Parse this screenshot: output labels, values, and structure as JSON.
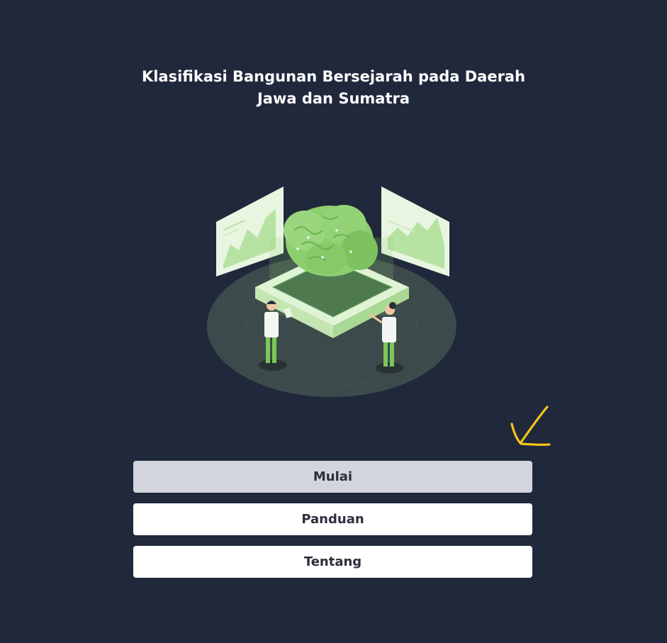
{
  "title": {
    "line1": "Klasifikasi Bangunan Bersejarah pada Daerah",
    "line2": "Jawa dan Sumatra"
  },
  "illustration": {
    "icon": "ai-brain-research-illustration",
    "colors": {
      "platform": "#3c4a4e",
      "brain": "#8ccf6e",
      "panel": "#e6f6df",
      "accent": "#7bc75a"
    }
  },
  "annotation": {
    "icon": "arrow-down-left-icon",
    "color": "#f5c518"
  },
  "menu": {
    "start_label": "Mulai",
    "guide_label": "Panduan",
    "about_label": "Tentang"
  },
  "colors": {
    "background": "#20283c",
    "button_active": "#d2d5dc",
    "button": "#ffffff",
    "button_text": "#2b2f3a"
  }
}
